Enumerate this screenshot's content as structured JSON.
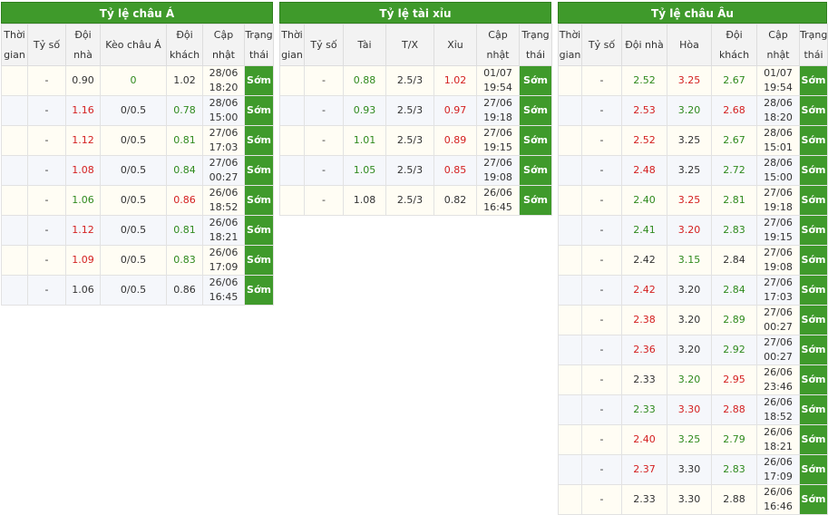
{
  "asian": {
    "title": "Tỷ lệ châu Á",
    "headers": [
      "Thời gian",
      "Tỷ số",
      "Đội nhà",
      "Kèo châu Á",
      "Đội khách",
      "Cập nhật",
      "Trạng thái"
    ],
    "rows": [
      {
        "time": "",
        "score": "-",
        "home": "0.90",
        "home_c": "nt",
        "line": "0",
        "line_c": "dn",
        "away": "1.02",
        "away_c": "nt",
        "upd": "28/06 18:20",
        "status": "Sớm"
      },
      {
        "time": "",
        "score": "-",
        "home": "1.16",
        "home_c": "up",
        "line": "0/0.5",
        "line_c": "nt",
        "away": "0.78",
        "away_c": "dn",
        "upd": "28/06 15:00",
        "status": "Sớm"
      },
      {
        "time": "",
        "score": "-",
        "home": "1.12",
        "home_c": "up",
        "line": "0/0.5",
        "line_c": "nt",
        "away": "0.81",
        "away_c": "dn",
        "upd": "27/06 17:03",
        "status": "Sớm"
      },
      {
        "time": "",
        "score": "-",
        "home": "1.08",
        "home_c": "up",
        "line": "0/0.5",
        "line_c": "nt",
        "away": "0.84",
        "away_c": "dn",
        "upd": "27/06 00:27",
        "status": "Sớm"
      },
      {
        "time": "",
        "score": "-",
        "home": "1.06",
        "home_c": "dn",
        "line": "0/0.5",
        "line_c": "nt",
        "away": "0.86",
        "away_c": "up",
        "upd": "26/06 18:52",
        "status": "Sớm"
      },
      {
        "time": "",
        "score": "-",
        "home": "1.12",
        "home_c": "up",
        "line": "0/0.5",
        "line_c": "nt",
        "away": "0.81",
        "away_c": "dn",
        "upd": "26/06 18:21",
        "status": "Sớm"
      },
      {
        "time": "",
        "score": "-",
        "home": "1.09",
        "home_c": "up",
        "line": "0/0.5",
        "line_c": "nt",
        "away": "0.83",
        "away_c": "dn",
        "upd": "26/06 17:09",
        "status": "Sớm"
      },
      {
        "time": "",
        "score": "-",
        "home": "1.06",
        "home_c": "nt",
        "line": "0/0.5",
        "line_c": "nt",
        "away": "0.86",
        "away_c": "nt",
        "upd": "26/06 16:45",
        "status": "Sớm"
      }
    ]
  },
  "overunder": {
    "title": "Tỷ lệ tài xỉu",
    "headers": [
      "Thời gian",
      "Tỷ số",
      "Tài",
      "T/X",
      "Xỉu",
      "Cập nhật",
      "Trạng thái"
    ],
    "rows": [
      {
        "time": "",
        "score": "-",
        "over": "0.88",
        "over_c": "dn",
        "line": "2.5/3",
        "under": "1.02",
        "under_c": "up",
        "upd": "01/07 19:54",
        "status": "Sớm"
      },
      {
        "time": "",
        "score": "-",
        "over": "0.93",
        "over_c": "dn",
        "line": "2.5/3",
        "under": "0.97",
        "under_c": "up",
        "upd": "27/06 19:18",
        "status": "Sớm"
      },
      {
        "time": "",
        "score": "-",
        "over": "1.01",
        "over_c": "dn",
        "line": "2.5/3",
        "under": "0.89",
        "under_c": "up",
        "upd": "27/06 19:15",
        "status": "Sớm"
      },
      {
        "time": "",
        "score": "-",
        "over": "1.05",
        "over_c": "dn",
        "line": "2.5/3",
        "under": "0.85",
        "under_c": "up",
        "upd": "27/06 19:08",
        "status": "Sớm"
      },
      {
        "time": "",
        "score": "-",
        "over": "1.08",
        "over_c": "nt",
        "line": "2.5/3",
        "under": "0.82",
        "under_c": "nt",
        "upd": "26/06 16:45",
        "status": "Sớm"
      }
    ]
  },
  "european": {
    "title": "Tỷ lệ châu Âu",
    "headers": [
      "Thời gian",
      "Tỷ số",
      "Đội nhà",
      "Hòa",
      "Đội khách",
      "Cập nhật",
      "Trạng thái"
    ],
    "rows": [
      {
        "time": "",
        "score": "-",
        "home": "2.52",
        "home_c": "dn",
        "draw": "3.25",
        "draw_c": "up",
        "away": "2.67",
        "away_c": "dn",
        "upd": "01/07 19:54",
        "status": "Sớm"
      },
      {
        "time": "",
        "score": "-",
        "home": "2.53",
        "home_c": "up",
        "draw": "3.20",
        "draw_c": "dn",
        "away": "2.68",
        "away_c": "up",
        "upd": "28/06 18:20",
        "status": "Sớm"
      },
      {
        "time": "",
        "score": "-",
        "home": "2.52",
        "home_c": "up",
        "draw": "3.25",
        "draw_c": "nt",
        "away": "2.67",
        "away_c": "dn",
        "upd": "28/06 15:01",
        "status": "Sớm"
      },
      {
        "time": "",
        "score": "-",
        "home": "2.48",
        "home_c": "up",
        "draw": "3.25",
        "draw_c": "nt",
        "away": "2.72",
        "away_c": "dn",
        "upd": "28/06 15:00",
        "status": "Sớm"
      },
      {
        "time": "",
        "score": "-",
        "home": "2.40",
        "home_c": "dn",
        "draw": "3.25",
        "draw_c": "up",
        "away": "2.81",
        "away_c": "dn",
        "upd": "27/06 19:18",
        "status": "Sớm"
      },
      {
        "time": "",
        "score": "-",
        "home": "2.41",
        "home_c": "dn",
        "draw": "3.20",
        "draw_c": "up",
        "away": "2.83",
        "away_c": "dn",
        "upd": "27/06 19:15",
        "status": "Sớm"
      },
      {
        "time": "",
        "score": "-",
        "home": "2.42",
        "home_c": "nt",
        "draw": "3.15",
        "draw_c": "dn",
        "away": "2.84",
        "away_c": "nt",
        "upd": "27/06 19:08",
        "status": "Sớm"
      },
      {
        "time": "",
        "score": "-",
        "home": "2.42",
        "home_c": "up",
        "draw": "3.20",
        "draw_c": "nt",
        "away": "2.84",
        "away_c": "dn",
        "upd": "27/06 17:03",
        "status": "Sớm"
      },
      {
        "time": "",
        "score": "-",
        "home": "2.38",
        "home_c": "up",
        "draw": "3.20",
        "draw_c": "nt",
        "away": "2.89",
        "away_c": "dn",
        "upd": "27/06 00:27",
        "status": "Sớm"
      },
      {
        "time": "",
        "score": "-",
        "home": "2.36",
        "home_c": "up",
        "draw": "3.20",
        "draw_c": "nt",
        "away": "2.92",
        "away_c": "dn",
        "upd": "27/06 00:27",
        "status": "Sớm"
      },
      {
        "time": "",
        "score": "-",
        "home": "2.33",
        "home_c": "nt",
        "draw": "3.20",
        "draw_c": "dn",
        "away": "2.95",
        "away_c": "up",
        "upd": "26/06 23:46",
        "status": "Sớm"
      },
      {
        "time": "",
        "score": "-",
        "home": "2.33",
        "home_c": "dn",
        "draw": "3.30",
        "draw_c": "up",
        "away": "2.88",
        "away_c": "up",
        "upd": "26/06 18:52",
        "status": "Sớm"
      },
      {
        "time": "",
        "score": "-",
        "home": "2.40",
        "home_c": "up",
        "draw": "3.25",
        "draw_c": "dn",
        "away": "2.79",
        "away_c": "dn",
        "upd": "26/06 18:21",
        "status": "Sớm"
      },
      {
        "time": "",
        "score": "-",
        "home": "2.37",
        "home_c": "up",
        "draw": "3.30",
        "draw_c": "nt",
        "away": "2.83",
        "away_c": "dn",
        "upd": "26/06 17:09",
        "status": "Sớm"
      },
      {
        "time": "",
        "score": "-",
        "home": "2.33",
        "home_c": "nt",
        "draw": "3.30",
        "draw_c": "nt",
        "away": "2.88",
        "away_c": "nt",
        "upd": "26/06 16:46",
        "status": "Sớm"
      }
    ]
  },
  "colors": {
    "header_green": "#3f9a2b",
    "up": "#d42020",
    "down": "#2f8a1e"
  }
}
